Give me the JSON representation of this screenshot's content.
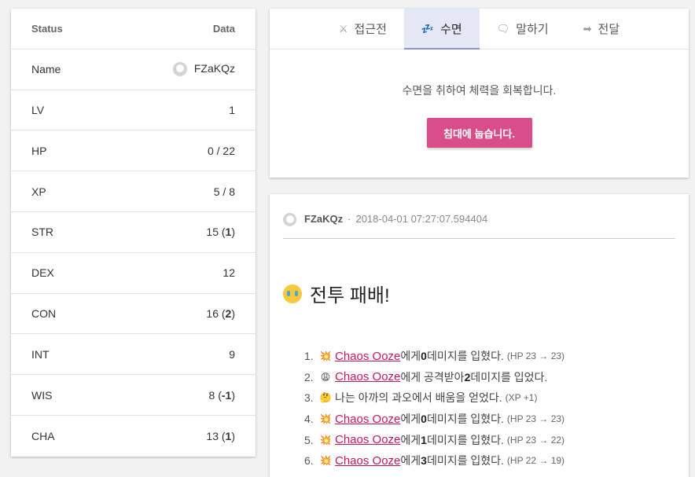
{
  "stats": {
    "header": {
      "label": "Status",
      "value": "Data"
    },
    "name": {
      "label": "Name",
      "value": "FZaKQz"
    },
    "rows": [
      {
        "label": "LV",
        "value": "1",
        "bonus": ""
      },
      {
        "label": "HP",
        "value": "0 / 22",
        "bonus": ""
      },
      {
        "label": "XP",
        "value": "5 / 8",
        "bonus": ""
      },
      {
        "label": "STR",
        "value": "15 (",
        "bonus": "1",
        "close": ")"
      },
      {
        "label": "DEX",
        "value": "12",
        "bonus": ""
      },
      {
        "label": "CON",
        "value": "16 (",
        "bonus": "2",
        "close": ")"
      },
      {
        "label": "INT",
        "value": "9",
        "bonus": ""
      },
      {
        "label": "WIS",
        "value": "8 (",
        "bonus": "-1",
        "close": ")"
      },
      {
        "label": "CHA",
        "value": "13 (",
        "bonus": "1",
        "close": ")"
      }
    ]
  },
  "tabs": [
    {
      "label": "접근전",
      "icon": "crossed-swords-icon",
      "glyph": "⚔",
      "active": false
    },
    {
      "label": "수면",
      "icon": "sleep-icon",
      "glyph": "💤",
      "active": true
    },
    {
      "label": "말하기",
      "icon": "speech-icon",
      "glyph": "🗨",
      "active": false
    },
    {
      "label": "전달",
      "icon": "forward-arrow-icon",
      "glyph": "➡",
      "active": false
    }
  ],
  "action": {
    "description": "수면을 취하여 체력을 회복합니다.",
    "button_label": "침대에 눕습니다."
  },
  "log": {
    "user": "FZaKQz",
    "separator": "·",
    "timestamp": "2018-04-01 07:27:07.594404",
    "title": "전투 패배!",
    "entries": [
      {
        "num": "1.",
        "glyph": "💥",
        "link": "Chaos Ooze",
        "pre": "에게 ",
        "bold": "0",
        "post": " 데미지를 입혔다.",
        "note": "(HP 23 → 23)"
      },
      {
        "num": "2.",
        "glyph": "😩",
        "link": "Chaos Ooze",
        "pre": "에게 공격받아 ",
        "bold": "2",
        "post": " 데미지를 입었다.",
        "note": ""
      },
      {
        "num": "3.",
        "glyph": "🤔",
        "link": "",
        "pre": "나는 아까의 과오에서 배움을 얻었다.",
        "bold": "",
        "post": "",
        "note": "(XP +1)"
      },
      {
        "num": "4.",
        "glyph": "💥",
        "link": "Chaos Ooze",
        "pre": "에게 ",
        "bold": "0",
        "post": " 데미지를 입혔다.",
        "note": "(HP 23 → 23)"
      },
      {
        "num": "5.",
        "glyph": "💥",
        "link": "Chaos Ooze",
        "pre": "에게 ",
        "bold": "1",
        "post": " 데미지를 입혔다.",
        "note": "(HP 23 → 22)"
      },
      {
        "num": "6.",
        "glyph": "💥",
        "link": "Chaos Ooze",
        "pre": "에게 ",
        "bold": "3",
        "post": " 데미지를 입혔다.",
        "note": "(HP 22 → 19)"
      }
    ]
  }
}
